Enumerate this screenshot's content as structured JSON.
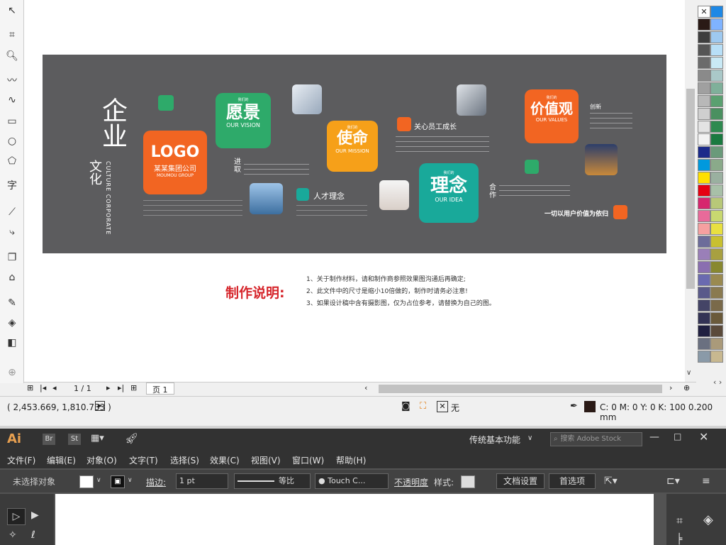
{
  "corel": {
    "page_nav": {
      "page_count": "1 / 1",
      "page_tab": "页 1"
    },
    "status": {
      "coords": "( 2,453.669, 1,810.733 )",
      "fill_none": "无",
      "outline": "C: 0 M: 0 Y: 0 K: 100  0.200 mm"
    },
    "colors": {
      "artboard": "#5c5c5e",
      "green": "#2eaa6a",
      "orange": "#f26522",
      "amber": "#f6a019",
      "teal": "#19a99a",
      "red_title": "#d6262c"
    }
  },
  "artboard": {
    "culture_big": "企业",
    "culture_small": "文化",
    "culture_en": "CULTURE CORPORATE",
    "logo": {
      "title": "LOGO",
      "company": "某某集团公司",
      "en": "MOUMOU GROUP"
    },
    "vision": {
      "small": "我们的",
      "title": "愿景",
      "en": "OUR VISION"
    },
    "mission": {
      "small": "我们的",
      "title": "使命",
      "en": "OUR MISSION"
    },
    "idea": {
      "small": "我们的",
      "title": "理念",
      "en": "OUR IDEA"
    },
    "values": {
      "small": "我们的",
      "title": "价值观",
      "en": "OUR VALUES"
    },
    "jinqu": "进取",
    "hezuo": "合作",
    "chuangxin": "创新",
    "talent": "人才理念",
    "care": "关心员工成长",
    "slogan": "一切以用户价值为依归"
  },
  "notes": {
    "title": "制作说明:",
    "lines": [
      "1、关于制作材料，请和制作商参照效果图沟通后再确定;",
      "2、此文件中的尺寸是缩小10倍做的，制作时请务必注意!",
      "3、如果设计稿中含有摄影图，仅为占位参考，请替换为自己的图。"
    ]
  },
  "ai": {
    "logo": "Ai",
    "br": "Br",
    "st": "St",
    "workspace": "传统基本功能",
    "search_placeholder": "搜索 Adobe Stock",
    "menu": [
      "文件(F)",
      "编辑(E)",
      "对象(O)",
      "文字(T)",
      "选择(S)",
      "效果(C)",
      "视图(V)",
      "窗口(W)",
      "帮助(H)"
    ],
    "control": {
      "no_selection": "未选择对象",
      "stroke_label": "描边:",
      "stroke_value": "1 pt",
      "profile": "等比",
      "brush": "Touch C...",
      "opacity": "不透明度",
      "style": "样式:",
      "doc_setup": "文档设置",
      "prefs": "首选项"
    }
  }
}
